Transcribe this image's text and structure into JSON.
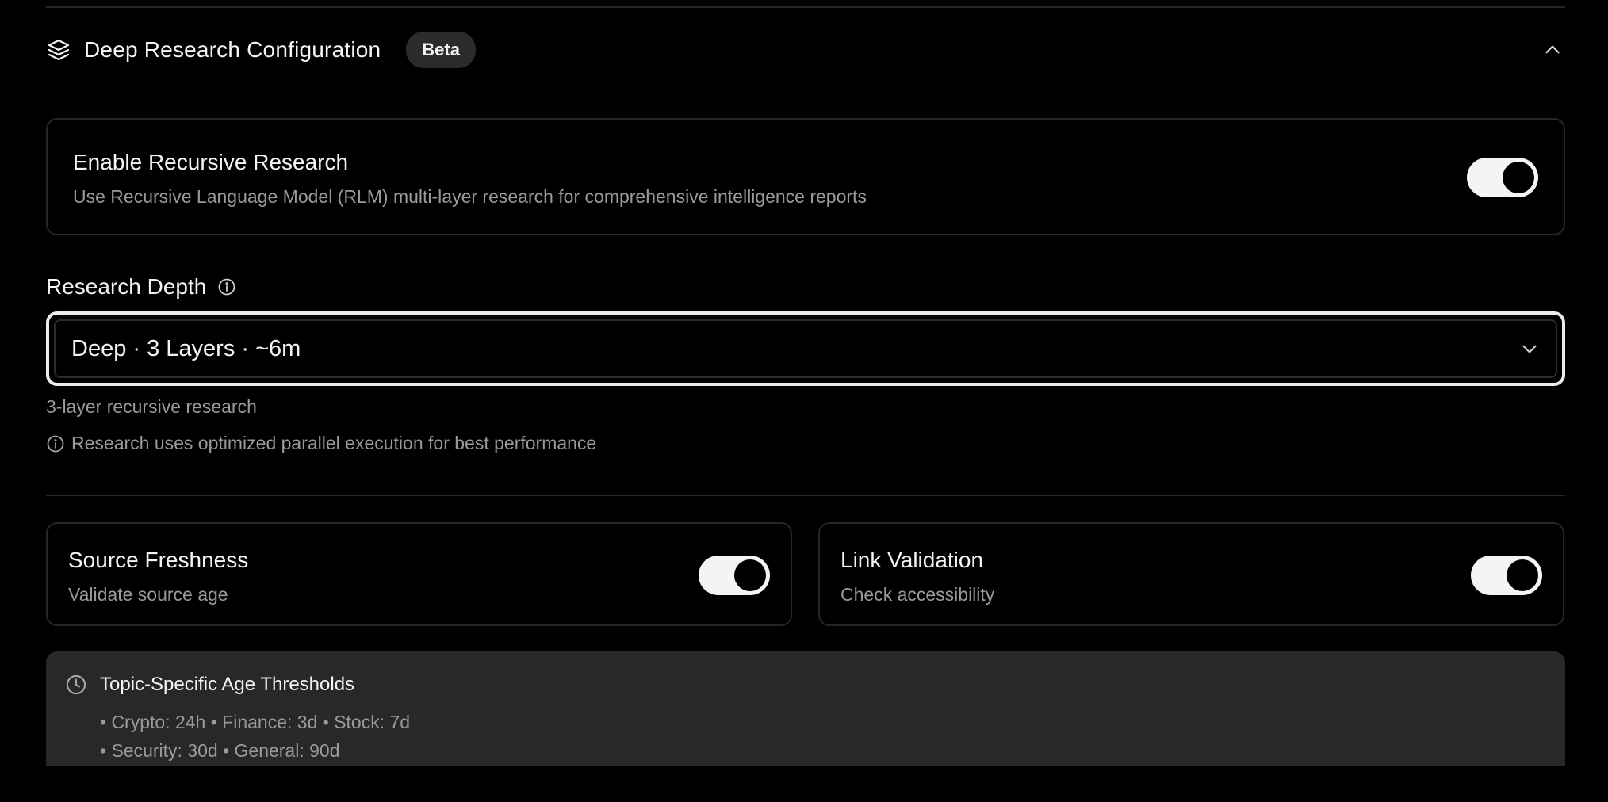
{
  "section": {
    "title": "Deep Research Configuration",
    "badge": "Beta",
    "header_icon": "layers-icon",
    "collapse_icon": "chevron-up-icon"
  },
  "recursive": {
    "title": "Enable Recursive Research",
    "description": "Use Recursive Language Model (RLM) multi-layer research for comprehensive intelligence reports",
    "enabled": true
  },
  "depth": {
    "label": "Research Depth",
    "selected": "Deep · 3 Layers · ~6m",
    "hint": "3-layer recursive research",
    "note": "Research uses optimized parallel execution for best performance"
  },
  "freshness": {
    "title": "Source Freshness",
    "description": "Validate source age",
    "enabled": true
  },
  "link_validation": {
    "title": "Link Validation",
    "description": "Check accessibility",
    "enabled": true
  },
  "thresholds": {
    "title": "Topic-Specific Age Thresholds",
    "line1": "• Crypto: 24h • Finance: 3d • Stock: 7d",
    "line2": "• Security: 30d • General: 90d"
  },
  "colors": {
    "background": "#000000",
    "card_border": "#262626",
    "panel": "#28282a",
    "muted_text": "#9a9a9a",
    "toggle_on": "#f4f4f4"
  }
}
